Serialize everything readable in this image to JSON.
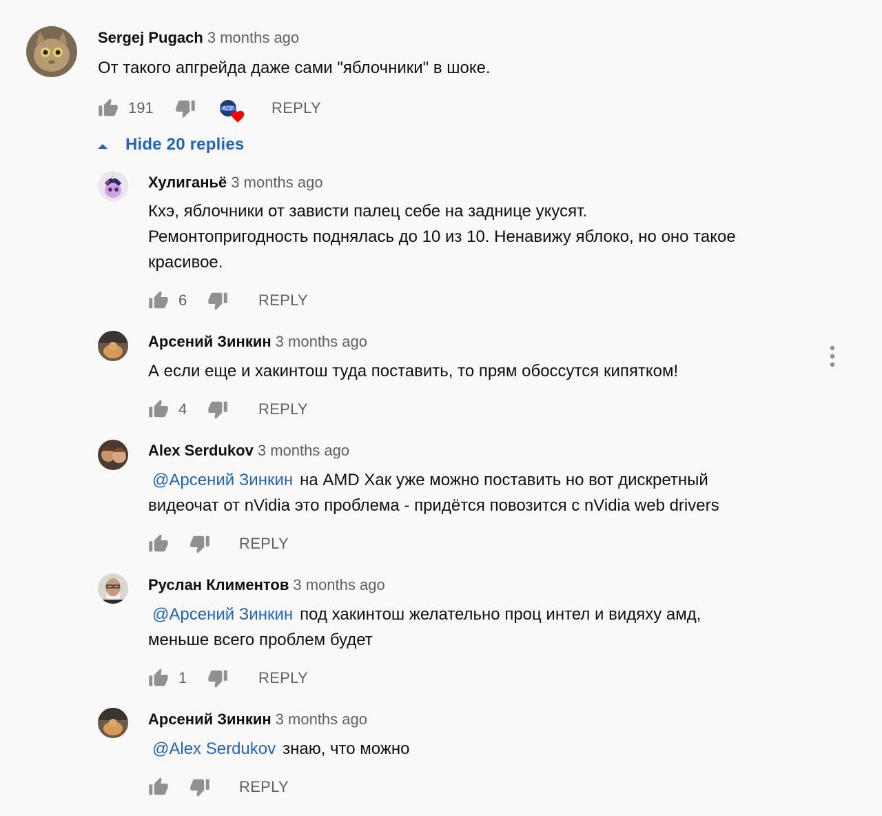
{
  "top_comment": {
    "author": "Sergej Pugach",
    "time": "3 months ago",
    "text": "От такого апгрейда даже сами \"яблочники\" в шоке.",
    "likes": "191",
    "reply_label": "REPLY",
    "hearted_by_creator": true
  },
  "replies_toggle": {
    "label": "Hide 20 replies"
  },
  "replies": [
    {
      "author": "Хулиганьё",
      "time": "3 months ago",
      "lines": [
        "Кхэ, яблочники от зависти палец себе на заднице укусят.",
        "Ремонтопригодность поднялась до 10 из 10. Ненавижу яблоко, но оно такое",
        "красивое."
      ],
      "likes": "6",
      "reply_label": "REPLY"
    },
    {
      "author": "Арсений Зинкин",
      "time": "3 months ago",
      "lines": [
        "А если еще и хакинтош туда поставить, то прям обоссутся кипятком!"
      ],
      "likes": "4",
      "reply_label": "REPLY"
    },
    {
      "author": "Alex Serdukov",
      "time": "3 months ago",
      "mention": "@Арсений Зинкин",
      "lines": [
        "на AMD Хак уже можно поставить но вот дискретный",
        "видеочат от nVidia это проблема - придётся повозится с nVidia web drivers"
      ],
      "likes": "",
      "reply_label": "REPLY"
    },
    {
      "author": "Руслан Климентов",
      "time": "3 months ago",
      "mention": "@Арсений Зинкин",
      "lines": [
        "под хакинтош желательно проц интел и видяху амд,",
        "меньше всего проблем будет"
      ],
      "likes": "1",
      "reply_label": "REPLY"
    },
    {
      "author": "Арсений Зинкин",
      "time": "3 months ago",
      "mention": "@Alex Serdukov",
      "lines": [
        "знаю, что можно"
      ],
      "likes": "",
      "reply_label": "REPLY"
    }
  ],
  "colors": {
    "background": "#f9f9f9",
    "link_blue": "#1f63c4",
    "secondary_text": "#606060",
    "icon_gray": "#909090",
    "heart_red": "#ff0000"
  }
}
